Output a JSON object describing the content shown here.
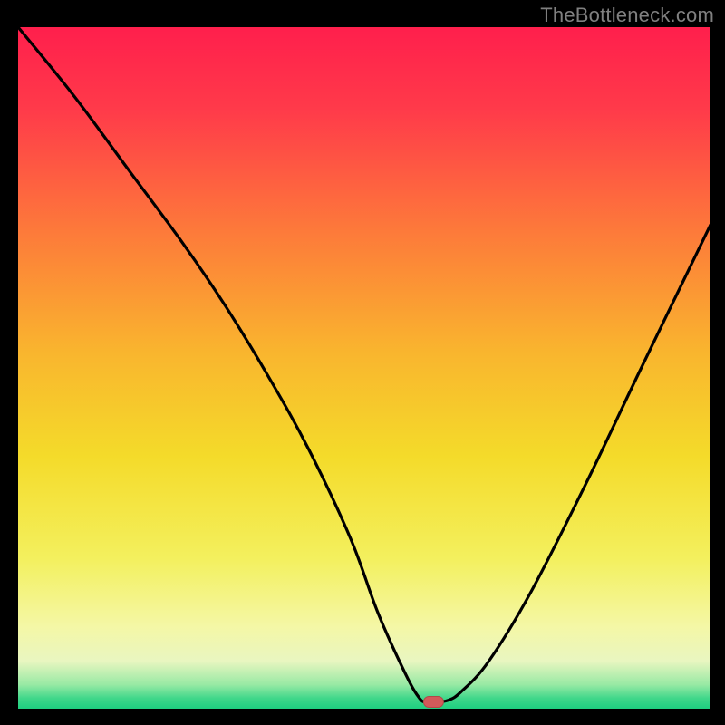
{
  "watermark": "TheBottleneck.com",
  "colors": {
    "frame": "#000000",
    "watermark": "#808080",
    "curve": "#000000",
    "marker_fill": "#d25a5a",
    "marker_stroke": "#b24848",
    "gradient_stops": [
      {
        "offset": 0.0,
        "color": "#ff1f4c"
      },
      {
        "offset": 0.12,
        "color": "#ff3a4a"
      },
      {
        "offset": 0.3,
        "color": "#fd7a3a"
      },
      {
        "offset": 0.48,
        "color": "#f9b62e"
      },
      {
        "offset": 0.63,
        "color": "#f4db2a"
      },
      {
        "offset": 0.78,
        "color": "#f3f05e"
      },
      {
        "offset": 0.88,
        "color": "#f4f7a6"
      },
      {
        "offset": 0.93,
        "color": "#e9f6c0"
      },
      {
        "offset": 0.965,
        "color": "#97e9a4"
      },
      {
        "offset": 0.985,
        "color": "#3fd78a"
      },
      {
        "offset": 1.0,
        "color": "#1ecf80"
      }
    ]
  },
  "chart_data": {
    "type": "line",
    "title": "",
    "xlabel": "",
    "ylabel": "",
    "xlim": [
      0,
      100
    ],
    "ylim": [
      0,
      100
    ],
    "x": [
      0,
      8,
      16,
      24,
      30,
      36,
      42,
      48,
      52,
      56,
      58,
      59,
      60,
      62,
      64,
      68,
      74,
      82,
      90,
      100
    ],
    "values": [
      100,
      90,
      79,
      68,
      59,
      49,
      38,
      25,
      14,
      5,
      1.5,
      1,
      1,
      1.2,
      2.5,
      7,
      17,
      33,
      50,
      71
    ],
    "marker": {
      "x": 60,
      "y": 1
    }
  }
}
